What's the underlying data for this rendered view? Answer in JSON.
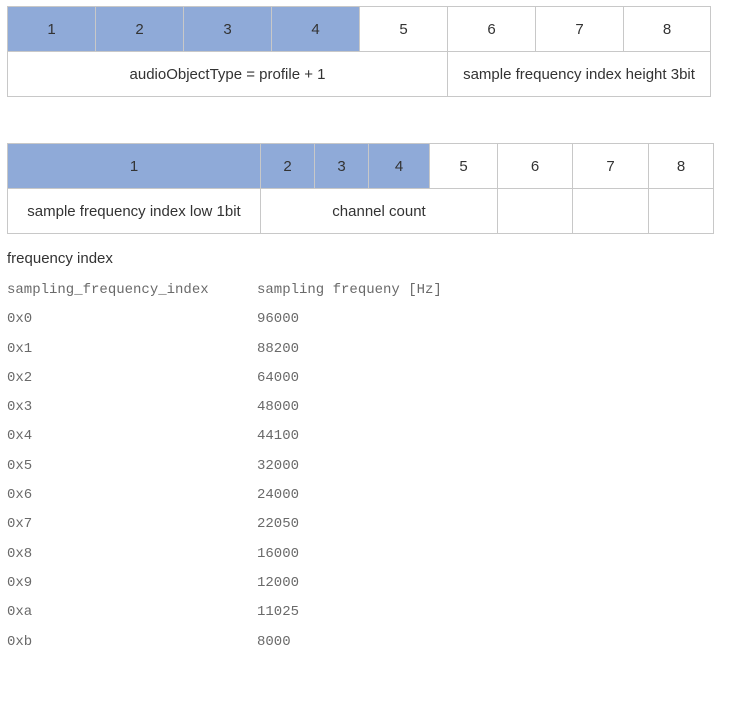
{
  "table1": {
    "bits": [
      "1",
      "2",
      "3",
      "4",
      "5",
      "6",
      "7",
      "8"
    ],
    "fields": [
      "audioObjectType = profile + 1",
      "sample frequency index height 3bit"
    ]
  },
  "table2": {
    "bits": [
      "1",
      "2",
      "3",
      "4",
      "5",
      "6",
      "7",
      "8"
    ],
    "fields": [
      "sample frequency index low 1bit",
      "channel count"
    ]
  },
  "frequency": {
    "heading": "frequency index",
    "col1_header": "sampling_frequency_index",
    "col2_header": "sampling frequeny [Hz]",
    "rows": [
      {
        "index": "0x0",
        "hz": "96000"
      },
      {
        "index": "0x1",
        "hz": "88200"
      },
      {
        "index": "0x2",
        "hz": "64000"
      },
      {
        "index": "0x3",
        "hz": "48000"
      },
      {
        "index": "0x4",
        "hz": "44100"
      },
      {
        "index": "0x5",
        "hz": "32000"
      },
      {
        "index": "0x6",
        "hz": "24000"
      },
      {
        "index": "0x7",
        "hz": "22050"
      },
      {
        "index": "0x8",
        "hz": "16000"
      },
      {
        "index": "0x9",
        "hz": "12000"
      },
      {
        "index": "0xa",
        "hz": "11025"
      },
      {
        "index": "0xb",
        "hz": "8000"
      }
    ]
  },
  "colors": {
    "highlight": "#8faad8",
    "border": "#c8c8c8",
    "text": "#333333",
    "mono_text": "#6a6a6a"
  }
}
